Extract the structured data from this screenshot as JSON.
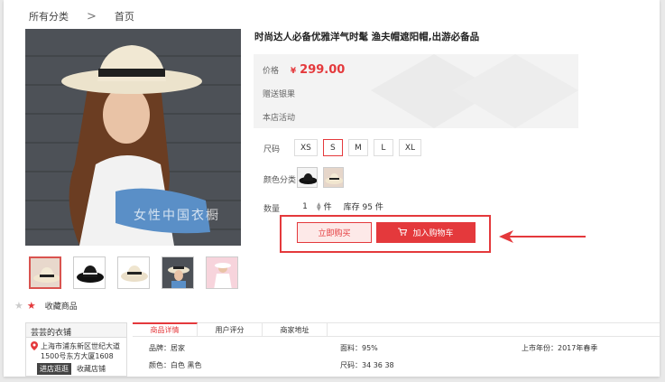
{
  "breadcrumb": {
    "root": "所有分类",
    "separator": ">",
    "current": "首页"
  },
  "product": {
    "title": "时尚达人必备优雅洋气时髦 渔夫帽遮阳帽,出游必备品",
    "price_label": "价格",
    "currency": "¥",
    "price": "299.00",
    "gift": "赠送银果",
    "promo": "本店活动",
    "watermark": "女性中国衣橱"
  },
  "options": {
    "size_label": "尺码",
    "sizes": [
      "XS",
      "S",
      "M",
      "L",
      "XL"
    ],
    "selected_size": "S",
    "color_label": "颜色分类",
    "qty_label": "数量",
    "qty_value": "1",
    "qty_unit": "件",
    "stock": "库存 95 件"
  },
  "buttons": {
    "buy_now": "立即购买",
    "add_cart": "加入购物车"
  },
  "favorite": {
    "label": "收藏商品"
  },
  "store": {
    "name": "芸芸的衣铺",
    "address": "上海市浦东新区世纪大道1500号东方大厦1608",
    "enter": "进店逛逛",
    "collect": "收藏店铺"
  },
  "tabs": [
    "商品详情",
    "用户评分",
    "商家地址"
  ],
  "attributes": {
    "brand": "品牌：居家",
    "fabric": "面料：95%",
    "season": "上市年份：2017年春季",
    "color": "颜色：白色 黑色",
    "size": "尺码：34 36 38"
  },
  "colors": {
    "accent": "#e4393c",
    "price_bg": "#f3f3f3"
  }
}
